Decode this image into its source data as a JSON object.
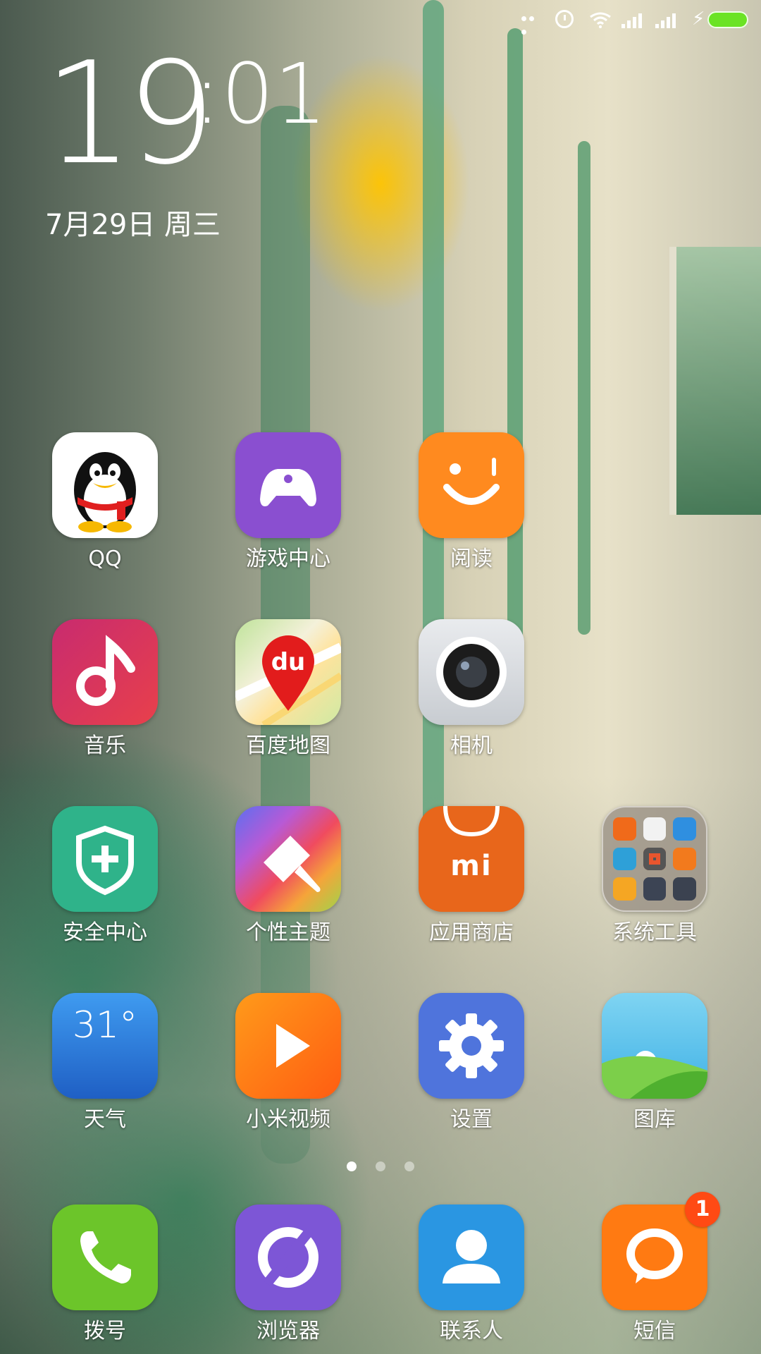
{
  "statusbar": {
    "icons": [
      "more-dots-icon",
      "alarm-icon",
      "wifi-icon",
      "signal-icon",
      "signal-icon",
      "charging-icon",
      "battery-icon"
    ],
    "battery_color": "#6be325"
  },
  "clock": {
    "hour": "19",
    "minute": ":01"
  },
  "date": "7月29日 周三",
  "apps": {
    "qq": {
      "label": "QQ",
      "color": "#ffffff"
    },
    "game_center": {
      "label": "游戏中心",
      "color": "#8a4fd0"
    },
    "reading": {
      "label": "阅读",
      "color": "#ff8a1f"
    },
    "music": {
      "label": "音乐",
      "color": "#d62f5a"
    },
    "baidu_map": {
      "label": "百度地图",
      "color": "#f0f0e8"
    },
    "camera": {
      "label": "相机",
      "color": "#dcdfe3"
    },
    "security": {
      "label": "安全中心",
      "color": "#2fb38a"
    },
    "themes": {
      "label": "个性主题",
      "color": "#e0513a"
    },
    "app_store": {
      "label": "应用商店",
      "color": "#f06a1a",
      "logo_text": "mi"
    },
    "system_tools": {
      "label": "系统工具",
      "color": "#8b847e"
    },
    "weather": {
      "label": "天气",
      "color": "#2a7fe0",
      "temperature": "31°"
    },
    "mi_video": {
      "label": "小米视频",
      "color": "#ff7a12"
    },
    "settings": {
      "label": "设置",
      "color": "#4f74dc"
    },
    "gallery": {
      "label": "图库",
      "color": "#56b9e8"
    }
  },
  "page_indicator": {
    "count": 3,
    "active": 1
  },
  "dock": {
    "dialer": {
      "label": "拨号",
      "color": "#6cc52a"
    },
    "browser": {
      "label": "浏览器",
      "color": "#7d56d6"
    },
    "contacts": {
      "label": "联系人",
      "color": "#2a96e2"
    },
    "messages": {
      "label": "短信",
      "color": "#ff7a12",
      "badge": "1"
    }
  }
}
